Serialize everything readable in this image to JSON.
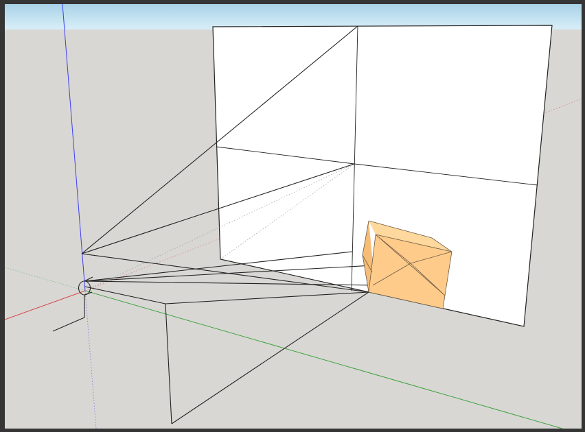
{
  "app": {
    "kind": "3d-modeling-viewport"
  },
  "scene": {
    "colors": {
      "sky_top": "#a9d2e8",
      "sky_bottom": "#d9eef7",
      "ground": "#d8d7d4",
      "window_bezel": "#353535",
      "panel_face": "#ffffff",
      "edge": "#222222",
      "box_front": "#ffcb8a",
      "box_top": "#ffd89e",
      "box_side": "#f6bd77",
      "axis_red": "#d94545",
      "axis_green": "#3fa33f",
      "axis_blue": "#3d3df0"
    },
    "objects": [
      "sky-band",
      "ground-plane",
      "red-axis",
      "green-axis",
      "blue-axis",
      "white-panel",
      "projection-frustum",
      "orange-box",
      "camera-eye-marker"
    ]
  }
}
